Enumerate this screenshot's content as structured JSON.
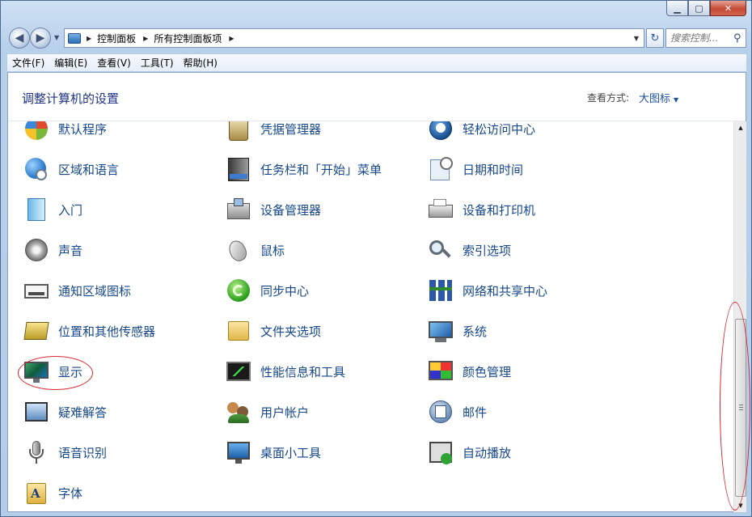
{
  "window": {
    "controls": {
      "minimize": "▁",
      "maximize": "▢",
      "close": "✕"
    }
  },
  "navigation": {
    "back_glyph": "◀",
    "forward_glyph": "▶",
    "history_drop": "▼",
    "breadcrumb": [
      "控制面板",
      "所有控制面板项"
    ],
    "separator": "▶",
    "address_drop": "▼",
    "refresh_glyph": "↻",
    "search_placeholder": "搜索控制...",
    "search_glyph": "⚲"
  },
  "menubar": [
    "文件(F)",
    "编辑(E)",
    "查看(V)",
    "工具(T)",
    "帮助(H)"
  ],
  "header": {
    "title": "调整计算机的设置",
    "viewby_label": "查看方式:",
    "viewby_value": "大图标",
    "viewby_arrow": "▼"
  },
  "items": [
    {
      "label": "默认程序",
      "icon": "default-programs-icon"
    },
    {
      "label": "凭据管理器",
      "icon": "credential-manager-icon"
    },
    {
      "label": "轻松访问中心",
      "icon": "ease-of-access-icon"
    },
    {
      "label": "区域和语言",
      "icon": "region-language-icon"
    },
    {
      "label": "任务栏和「开始」菜单",
      "icon": "taskbar-icon"
    },
    {
      "label": "日期和时间",
      "icon": "date-time-icon"
    },
    {
      "label": "入门",
      "icon": "getting-started-icon"
    },
    {
      "label": "设备管理器",
      "icon": "device-manager-icon"
    },
    {
      "label": "设备和打印机",
      "icon": "devices-printers-icon"
    },
    {
      "label": "声音",
      "icon": "sound-icon"
    },
    {
      "label": "鼠标",
      "icon": "mouse-icon"
    },
    {
      "label": "索引选项",
      "icon": "indexing-options-icon"
    },
    {
      "label": "通知区域图标",
      "icon": "notification-area-icon"
    },
    {
      "label": "同步中心",
      "icon": "sync-center-icon"
    },
    {
      "label": "网络和共享中心",
      "icon": "network-sharing-icon"
    },
    {
      "label": "位置和其他传感器",
      "icon": "location-sensors-icon"
    },
    {
      "label": "文件夹选项",
      "icon": "folder-options-icon"
    },
    {
      "label": "系统",
      "icon": "system-icon"
    },
    {
      "label": "显示",
      "icon": "display-icon"
    },
    {
      "label": "性能信息和工具",
      "icon": "performance-icon"
    },
    {
      "label": "颜色管理",
      "icon": "color-management-icon"
    },
    {
      "label": "疑难解答",
      "icon": "troubleshooting-icon"
    },
    {
      "label": "用户帐户",
      "icon": "user-accounts-icon"
    },
    {
      "label": "邮件",
      "icon": "mail-icon"
    },
    {
      "label": "语音识别",
      "icon": "speech-recognition-icon"
    },
    {
      "label": "桌面小工具",
      "icon": "desktop-gadgets-icon"
    },
    {
      "label": "自动播放",
      "icon": "autoplay-icon"
    },
    {
      "label": "字体",
      "icon": "fonts-icon"
    }
  ],
  "scrollbar": {
    "up_glyph": "▲",
    "down_glyph": "▼",
    "scroll_position": 1.0
  },
  "annotation_color": "#d9262d"
}
